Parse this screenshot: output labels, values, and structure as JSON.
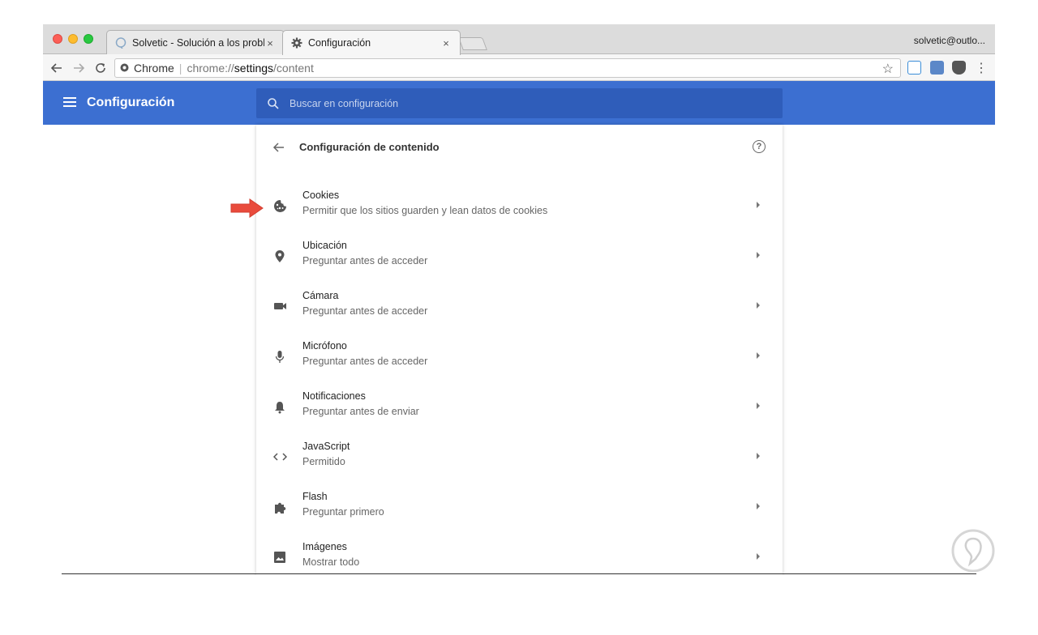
{
  "browser": {
    "tabs": [
      {
        "title": "Solvetic - Solución a los probl",
        "close": "×"
      },
      {
        "title": "Configuración",
        "close": "×"
      }
    ],
    "profile": "solvetic@outlo...",
    "omnibox": {
      "scheme_label": "Chrome",
      "url_prefix": "chrome://",
      "url_host": "settings",
      "url_path": "/content"
    },
    "star": "☆"
  },
  "app": {
    "title": "Configuración",
    "search_placeholder": "Buscar en configuración"
  },
  "card": {
    "title": "Configuración de contenido",
    "help": "?",
    "rows": [
      {
        "title": "Cookies",
        "subtitle": "Permitir que los sitios guarden y lean datos de cookies",
        "icon": "cookie-icon"
      },
      {
        "title": "Ubicación",
        "subtitle": "Preguntar antes de acceder",
        "icon": "location-icon"
      },
      {
        "title": "Cámara",
        "subtitle": "Preguntar antes de acceder",
        "icon": "camera-icon"
      },
      {
        "title": "Micrófono",
        "subtitle": "Preguntar antes de acceder",
        "icon": "microphone-icon"
      },
      {
        "title": "Notificaciones",
        "subtitle": "Preguntar antes de enviar",
        "icon": "bell-icon"
      },
      {
        "title": "JavaScript",
        "subtitle": "Permitido",
        "icon": "code-icon"
      },
      {
        "title": "Flash",
        "subtitle": "Preguntar primero",
        "icon": "puzzle-icon"
      },
      {
        "title": "Imágenes",
        "subtitle": "Mostrar todo",
        "icon": "image-icon"
      }
    ]
  },
  "colors": {
    "appbar": "#3c6fd1",
    "search_bg": "#2f5dba",
    "pointer_arrow": "#e94b3c"
  }
}
